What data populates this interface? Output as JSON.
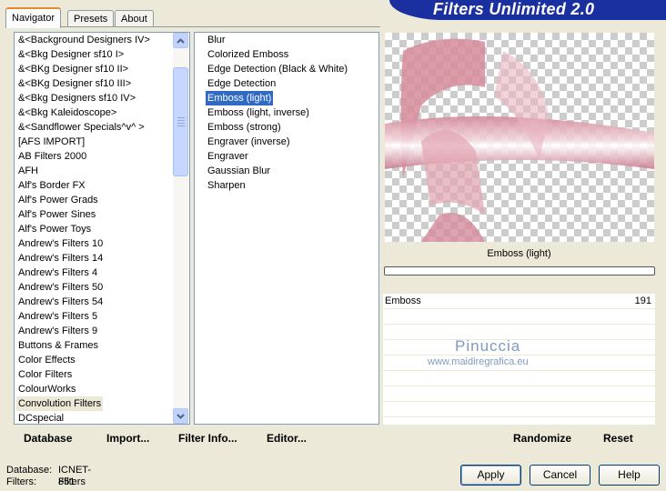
{
  "app": {
    "title": "Filters Unlimited 2.0"
  },
  "tabs": [
    {
      "label": "Navigator",
      "active": true
    },
    {
      "label": "Presets",
      "active": false
    },
    {
      "label": "About",
      "active": false
    }
  ],
  "categories": {
    "items": [
      "&<Background Designers IV>",
      "&<Bkg Designer sf10 I>",
      "&<BKg Designer sf10 II>",
      "&<BKg Designer sf10 III>",
      "&<Bkg Designers sf10 IV>",
      "&<Bkg Kaleidoscope>",
      "&<Sandflower Specials^v^ >",
      "[AFS IMPORT]",
      "AB Filters 2000",
      "AFH",
      "Alf's Border FX",
      "Alf's Power Grads",
      "Alf's Power Sines",
      "Alf's Power Toys",
      "Andrew's Filters 10",
      "Andrew's Filters 14",
      "Andrew's Filters 4",
      "Andrew's Filters 50",
      "Andrew's Filters 54",
      "Andrew's Filters 5",
      "Andrew's Filters 9",
      "Buttons & Frames",
      "Color Effects",
      "Color Filters",
      "ColourWorks",
      "Convolution Filters",
      "DCspecial"
    ],
    "selected": "Convolution Filters"
  },
  "filters": {
    "items": [
      "Blur",
      "Colorized Emboss",
      "Edge Detection (Black & White)",
      "Edge Detection",
      "Emboss (light)",
      "Emboss (light, inverse)",
      "Emboss (strong)",
      "Engraver (inverse)",
      "Engraver",
      "Gaussian Blur",
      "Sharpen"
    ],
    "selected": "Emboss (light)"
  },
  "preview": {
    "filter_name": "Emboss (light)",
    "progress_fraction": 0,
    "colors": {
      "pink": "#d4899a",
      "light": "#f3d7dd"
    }
  },
  "params": [
    {
      "label": "Emboss",
      "value": "191"
    }
  ],
  "watermark": {
    "line1": "Pinuccia",
    "line2": "www.maidiregrafica.eu"
  },
  "commands_left": [
    {
      "label": "Database"
    },
    {
      "label": "Import..."
    },
    {
      "label": "Filter Info..."
    },
    {
      "label": "Editor..."
    }
  ],
  "commands_right": [
    {
      "label": "Randomize"
    },
    {
      "label": "Reset"
    }
  ],
  "database_info": {
    "database_label": "Database:",
    "database_value": "ICNET-Filters",
    "filters_label": "Filters:",
    "filters_value": "851"
  },
  "buttons": {
    "apply": "Apply",
    "cancel": "Cancel",
    "help": "Help"
  },
  "icons": {
    "scroll_up": "chevron-up-icon",
    "scroll_down": "chevron-down-icon"
  }
}
